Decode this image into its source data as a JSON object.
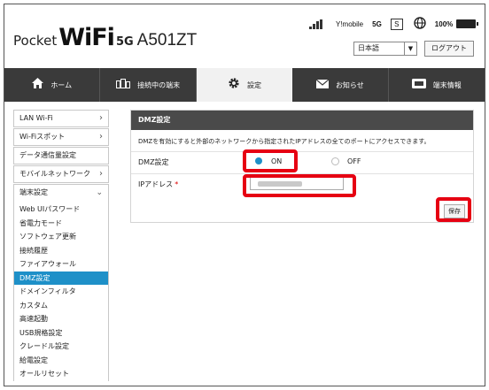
{
  "brand": {
    "part1": "Pocket",
    "part2": "WiFi",
    "part3": "5G",
    "model": "A501ZT"
  },
  "status": {
    "carrier": "Y!mobile",
    "network": "5G",
    "sim": "S",
    "battery": "100%"
  },
  "language": {
    "selected": "日本語"
  },
  "logout_label": "ログアウト",
  "nav": [
    {
      "label": "ホーム",
      "icon": "home-icon"
    },
    {
      "label": "接続中の端末",
      "icon": "devices-icon"
    },
    {
      "label": "設定",
      "icon": "gear-icon"
    },
    {
      "label": "お知らせ",
      "icon": "mail-icon"
    },
    {
      "label": "端末情報",
      "icon": "device-info-icon"
    }
  ],
  "sidebar": {
    "items": [
      "LAN Wi-Fi",
      "Wi-Fiスポット",
      "データ通信量設定",
      "モバイルネットワーク"
    ],
    "group_title": "端末設定",
    "sub_items": [
      "Web UIパスワード",
      "省電力モード",
      "ソフトウェア更新",
      "接続履歴",
      "ファイアウォール",
      "DMZ設定",
      "ドメインフィルタ",
      "カスタム",
      "高速起動",
      "USB規格設定",
      "クレードル設定",
      "給電設定",
      "オールリセット"
    ]
  },
  "panel": {
    "title": "DMZ設定",
    "description": "DMZを有効にすると外部のネットワークから指定されたIPアドレスの全てのポートにアクセスできます。",
    "dmz_label": "DMZ設定",
    "on_label": "ON",
    "off_label": "OFF",
    "ip_label": "IPアドレス",
    "required_mark": "*",
    "save_label": "保存"
  },
  "colors": {
    "accent": "#1e90c8",
    "highlight": "#e60012",
    "nav_bg": "#3a3a3a",
    "panel_header": "#4a4a4a"
  }
}
